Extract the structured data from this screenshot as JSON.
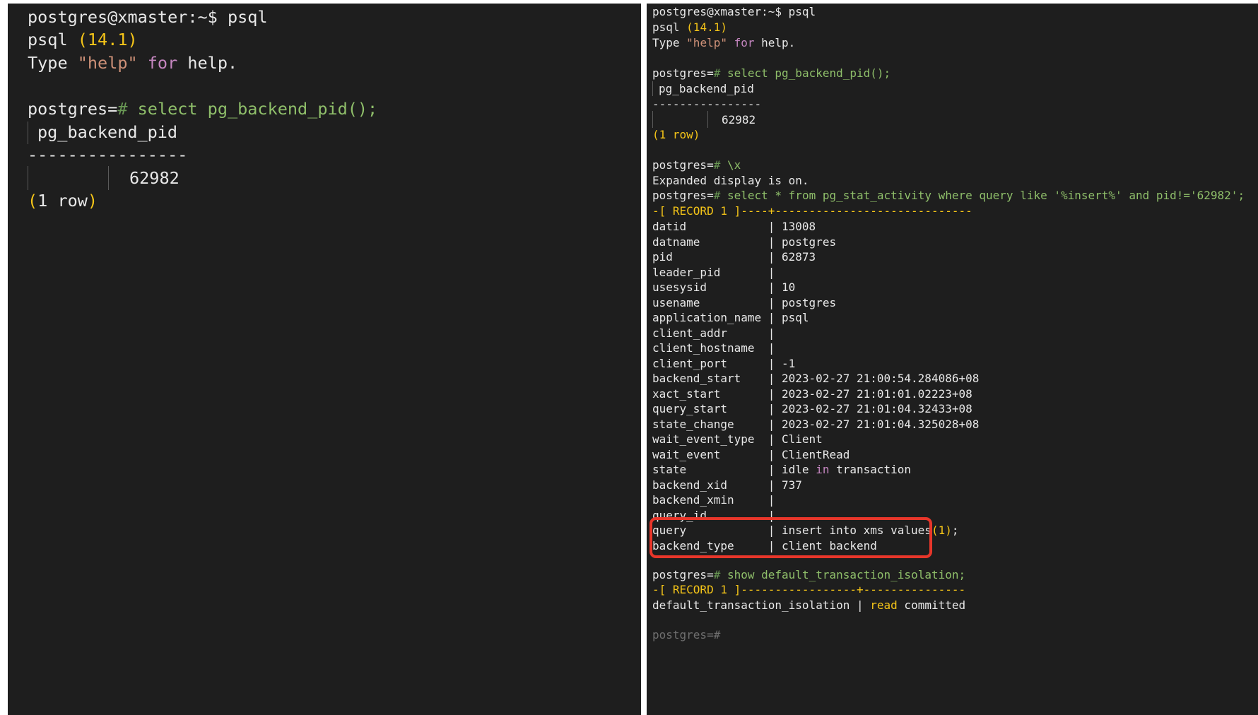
{
  "left": {
    "prompt_host": "postgres@xmaster:~$ psql",
    "version_prefix": "psql ",
    "version": "(14.1)",
    "help_type": "Type ",
    "help_word": "\"help\"",
    "help_for": " for",
    "help_rest": " help.",
    "prompt": "postgres=",
    "prompt_hash": "#",
    "query": " select pg_backend_pid();",
    "column_header": "pg_backend_pid",
    "separator": "----------------",
    "value": "62982",
    "row_count_open": "(",
    "row_count_text": "1 row",
    "row_count_close": ")"
  },
  "right": {
    "prompt_host": "postgres@xmaster:~$ psql",
    "version_prefix": "psql ",
    "version": "(14.1)",
    "help_type": "Type ",
    "help_word": "\"help\"",
    "help_for": " for",
    "help_rest": " help.",
    "prompt": "postgres=",
    "prompt_hash": "#",
    "query1": " select pg_backend_pid();",
    "column_header": "pg_backend_pid",
    "separator": "----------------",
    "value": "62982",
    "row_count": "(1 row)",
    "query2": " \\x",
    "expanded_msg": "Expanded display is on.",
    "query3": " select * from pg_stat_activity where query like '%insert%' and pid!='62982';",
    "record_header_1": "-[ RECORD 1 ]----+-----------------------------",
    "records": [
      {
        "key": "datid",
        "value": "13008"
      },
      {
        "key": "datname",
        "value": "postgres"
      },
      {
        "key": "pid",
        "value": "62873"
      },
      {
        "key": "leader_pid",
        "value": ""
      },
      {
        "key": "usesysid",
        "value": "10"
      },
      {
        "key": "usename",
        "value": "postgres"
      },
      {
        "key": "application_name",
        "value": "psql"
      },
      {
        "key": "client_addr",
        "value": ""
      },
      {
        "key": "client_hostname",
        "value": ""
      },
      {
        "key": "client_port",
        "value": "-1"
      },
      {
        "key": "backend_start",
        "value": "2023-02-27 21:00:54.284086+08"
      },
      {
        "key": "xact_start",
        "value": "2023-02-27 21:01:01.02223+08"
      },
      {
        "key": "query_start",
        "value": "2023-02-27 21:01:04.32433+08"
      },
      {
        "key": "state_change",
        "value": "2023-02-27 21:01:04.325028+08"
      },
      {
        "key": "wait_event_type",
        "value": "Client"
      },
      {
        "key": "wait_event",
        "value": "ClientRead"
      },
      {
        "key": "state",
        "value": "idle in transaction"
      },
      {
        "key": "backend_xid",
        "value": "737"
      },
      {
        "key": "backend_xmin",
        "value": ""
      },
      {
        "key": "query_id",
        "value": ""
      },
      {
        "key": "query",
        "value": "insert into xms values(1);"
      },
      {
        "key": "backend_type",
        "value": "client backend"
      }
    ],
    "state_idle": "idle ",
    "state_in": "in",
    "state_rest": " transaction",
    "insert_pre": "insert into xms values",
    "insert_arg": "(1)",
    "insert_post": ";",
    "query4": " show default_transaction_isolation;",
    "record_header_2": "-[ RECORD 1 ]-----------------+---------------",
    "iso_key": "default_transaction_isolation",
    "iso_sep": " | ",
    "iso_read": "read",
    "iso_committed": " committed",
    "last_prompt": "postgres=#",
    "highlight_color": "#e8362a"
  }
}
